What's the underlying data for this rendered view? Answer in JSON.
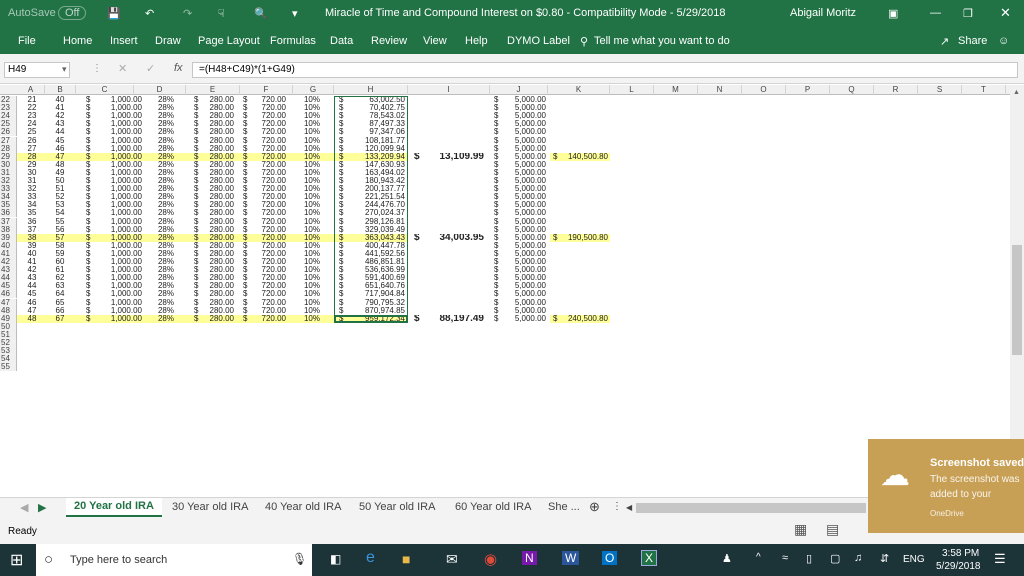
{
  "titlebar": {
    "autosave": "AutoSave",
    "autosave_state": "Off",
    "doc_title": "Miracle of Time and Compound Interest on $0.80  -  Compatibility Mode  -  5/29/2018",
    "user": "Abigail Moritz"
  },
  "ribbon": {
    "tabs": [
      "File",
      "Home",
      "Insert",
      "Draw",
      "Page Layout",
      "Formulas",
      "Data",
      "Review",
      "View",
      "Help",
      "DYMO Label"
    ],
    "tell_me": "Tell me what you want to do",
    "share": "Share"
  },
  "formula_bar": {
    "name_box": "H49",
    "fx": "fx",
    "formula": "=(H48+C49)*(1+G49)"
  },
  "columns": [
    "A",
    "B",
    "C",
    "D",
    "E",
    "F",
    "G",
    "H",
    "I",
    "J",
    "K",
    "L",
    "M",
    "N",
    "O",
    "P",
    "Q",
    "R",
    "S",
    "T"
  ],
  "rows": [
    {
      "n": "22",
      "a": "21",
      "b": "40",
      "h": "63,002.50",
      "i": "",
      "k": ""
    },
    {
      "n": "23",
      "a": "22",
      "b": "41",
      "h": "70,402.75",
      "i": "",
      "k": ""
    },
    {
      "n": "24",
      "a": "23",
      "b": "42",
      "h": "78,543.02",
      "i": "",
      "k": ""
    },
    {
      "n": "25",
      "a": "24",
      "b": "43",
      "h": "87,497.33",
      "i": "",
      "k": ""
    },
    {
      "n": "26",
      "a": "25",
      "b": "44",
      "h": "97,347.06",
      "i": "",
      "k": ""
    },
    {
      "n": "27",
      "a": "26",
      "b": "45",
      "h": "108,181.77",
      "i": "",
      "k": ""
    },
    {
      "n": "28",
      "a": "27",
      "b": "46",
      "h": "120,099.94",
      "i": "",
      "k": ""
    },
    {
      "n": "29",
      "a": "28",
      "b": "47",
      "h": "133,209.94",
      "i": "13,109.99",
      "k": "140,500.80",
      "hl": true
    },
    {
      "n": "30",
      "a": "29",
      "b": "48",
      "h": "147,630.93",
      "i": "",
      "k": ""
    },
    {
      "n": "31",
      "a": "30",
      "b": "49",
      "h": "163,494.02",
      "i": "",
      "k": ""
    },
    {
      "n": "32",
      "a": "31",
      "b": "50",
      "h": "180,943.42",
      "i": "",
      "k": ""
    },
    {
      "n": "33",
      "a": "32",
      "b": "51",
      "h": "200,137.77",
      "i": "",
      "k": ""
    },
    {
      "n": "34",
      "a": "33",
      "b": "52",
      "h": "221,251.54",
      "i": "",
      "k": ""
    },
    {
      "n": "35",
      "a": "34",
      "b": "53",
      "h": "244,476.70",
      "i": "",
      "k": ""
    },
    {
      "n": "36",
      "a": "35",
      "b": "54",
      "h": "270,024.37",
      "i": "",
      "k": ""
    },
    {
      "n": "37",
      "a": "36",
      "b": "55",
      "h": "298,126.81",
      "i": "",
      "k": ""
    },
    {
      "n": "38",
      "a": "37",
      "b": "56",
      "h": "329,039.49",
      "i": "",
      "k": ""
    },
    {
      "n": "39",
      "a": "38",
      "b": "57",
      "h": "363,043.43",
      "i": "34,003.95",
      "k": "190,500.80",
      "hl": true
    },
    {
      "n": "40",
      "a": "39",
      "b": "58",
      "h": "400,447.78",
      "i": "",
      "k": ""
    },
    {
      "n": "41",
      "a": "40",
      "b": "59",
      "h": "441,592.56",
      "i": "",
      "k": ""
    },
    {
      "n": "42",
      "a": "41",
      "b": "60",
      "h": "486,851.81",
      "i": "",
      "k": ""
    },
    {
      "n": "43",
      "a": "42",
      "b": "61",
      "h": "536,636.99",
      "i": "",
      "k": ""
    },
    {
      "n": "44",
      "a": "43",
      "b": "62",
      "h": "591,400.69",
      "i": "",
      "k": ""
    },
    {
      "n": "45",
      "a": "44",
      "b": "63",
      "h": "651,640.76",
      "i": "",
      "k": ""
    },
    {
      "n": "46",
      "a": "45",
      "b": "64",
      "h": "717,904.84",
      "i": "",
      "k": ""
    },
    {
      "n": "47",
      "a": "46",
      "b": "65",
      "h": "790,795.32",
      "i": "",
      "k": ""
    },
    {
      "n": "48",
      "a": "47",
      "b": "66",
      "h": "870,974.85",
      "i": "",
      "k": ""
    },
    {
      "n": "49",
      "a": "48",
      "b": "67",
      "h": "959,172.34",
      "i": "88,197.49",
      "k": "240,500.80",
      "hl": true
    }
  ],
  "constants": {
    "dollar": "$",
    "c": "1,000.00",
    "d": "28%",
    "e": "280.00",
    "f": "720.00",
    "g": "10%",
    "j": "5,000.00"
  },
  "empty_rows": [
    "50",
    "51",
    "52",
    "53",
    "54",
    "55"
  ],
  "sheet_tabs": [
    "20 Year old IRA",
    "30 Year old IRA",
    "40 Year old IRA",
    "50 Year old IRA",
    "60 Year old IRA",
    "She ..."
  ],
  "status": "Ready",
  "toast": {
    "title": "Screenshot saved",
    "body": "The screenshot was added to your OneDrive.",
    "source": "OneDrive"
  },
  "taskbar": {
    "search": "Type here to search",
    "time": "3:58 PM",
    "date": "5/29/2018",
    "lang": "ENG"
  },
  "colors": {
    "excel_green": "#217346",
    "highlight": "#ffff99",
    "taskbar": "#1c3338",
    "toast": "#c8a055"
  }
}
